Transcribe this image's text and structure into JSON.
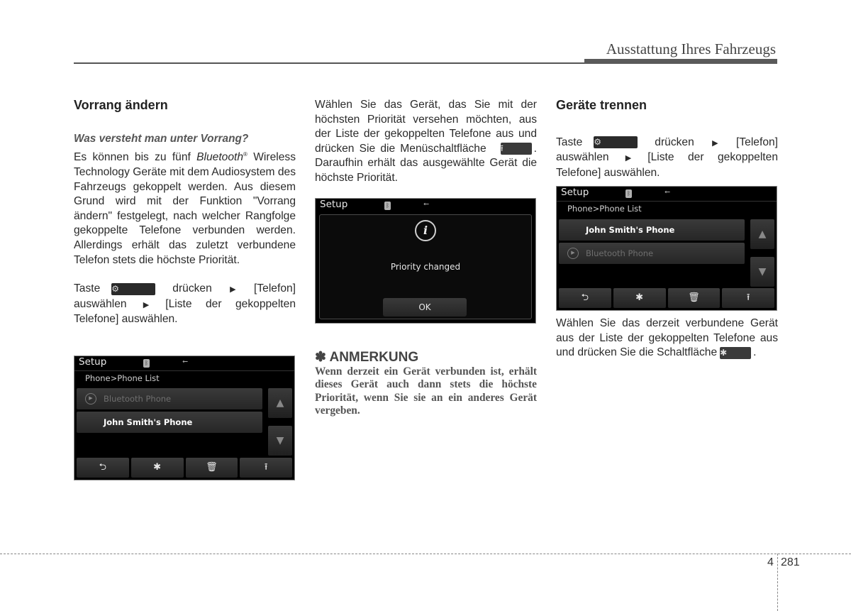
{
  "header": {
    "title": "Ausstattung Ihres Fahrzeugs"
  },
  "col1": {
    "heading": "Vorrang ändern",
    "subheading": "Was versteht man unter Vorrang?",
    "para1_pre": "Es können bis zu fünf ",
    "para1_italic": "Bluetooth",
    "para1_reg": "®",
    "para1_post": " Wireless Technology Geräte mit dem Audiosystem des Fahrzeugs gekoppelt werden. Aus diesem Grund wird mit der Funktion \"Vorrang ändern\" festgelegt, nach welcher Rangfolge gekoppelte Telefone verbunden werden. Allerdings erhält das zuletzt verbundene Telefon stets die höchste Priorität.",
    "step_taste": "Taste",
    "step_druecken": "drücken",
    "step_telefon": "[Telefon] auswählen",
    "step_liste": "[Liste der gekoppelten Telefone] auswählen.",
    "screen": {
      "title": "Setup",
      "breadcrumb": "Phone>Phone List",
      "items": [
        {
          "label": "Bluetooth Phone",
          "state": "dim"
        },
        {
          "label": "John Smith's Phone",
          "state": "selected"
        }
      ],
      "bottom_icons": [
        "back-icon",
        "bluetooth-connect-icon",
        "delete-icon",
        "move-to-top-icon"
      ]
    }
  },
  "col2": {
    "para": "Wählen Sie das Gerät, das Sie mit der höchsten Priorität versehen möchten, aus der Liste der gekoppelten Telefone aus und drücken Sie die Menüschaltfläche",
    "para_post": ". Daraufhin erhält das ausgewählte Gerät die höchste Priorität.",
    "screen": {
      "title": "Setup",
      "message": "Priority changed",
      "ok_label": "OK"
    },
    "note_title": "✽ ANMERKUNG",
    "note_body": "Wenn derzeit ein Gerät verbunden ist, erhält dieses Gerät auch dann stets die höchste Priorität, wenn Sie sie an ein anderes Gerät vergeben."
  },
  "col3": {
    "heading": "Geräte trennen",
    "step_taste": "Taste",
    "step_druecken": "drücken",
    "step_telefon": "[Telefon] auswählen",
    "step_liste": "[Liste der gekoppelten Telefone] auswählen.",
    "screen": {
      "title": "Setup",
      "breadcrumb": "Phone>Phone List",
      "items": [
        {
          "label": "John Smith's Phone",
          "state": "selected"
        },
        {
          "label": "Bluetooth Phone",
          "state": "dim"
        }
      ],
      "bottom_icons": [
        "back-icon",
        "bluetooth-disconnect-icon",
        "delete-icon",
        "move-to-top-icon"
      ]
    },
    "para": "Wählen Sie das derzeit verbundene Gerät aus der Liste der gekoppelten Telefone aus und drücken Sie die Schaltfläche",
    "para_post": "."
  },
  "footer": {
    "chapter": "4",
    "page": "281"
  },
  "glyphs": {
    "gear": "⚙",
    "arrow": "▶",
    "up": "▲",
    "down": "▼",
    "back": "⮌",
    "bt": "✱",
    "trash": "🗑",
    "top": "⭱",
    "play": "▶",
    "info": "i",
    "bt_small": "ᛒ",
    "usb": "⭠"
  }
}
